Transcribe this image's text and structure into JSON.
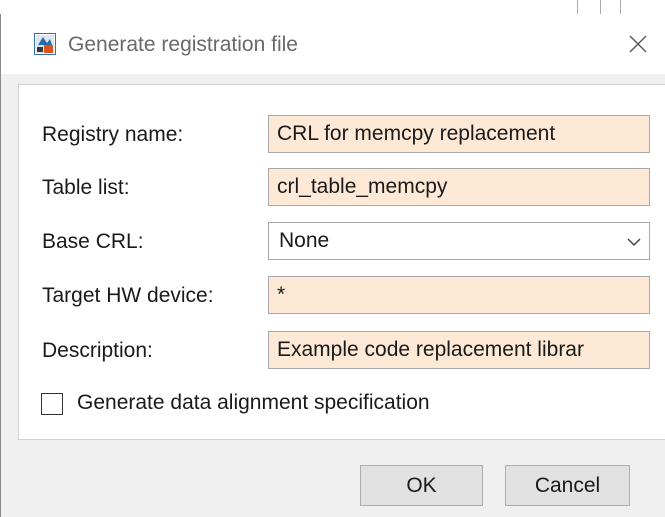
{
  "dialog": {
    "title": "Generate registration file",
    "icon": "simulink-app-icon",
    "close_icon": "close-icon"
  },
  "form": {
    "registry_name": {
      "label": "Registry name:",
      "value": "CRL for memcpy replacement"
    },
    "table_list": {
      "label": "Table list:",
      "value": "crl_table_memcpy"
    },
    "base_crl": {
      "label": "Base CRL:",
      "value": "None"
    },
    "target_hw": {
      "label": "Target HW device:",
      "value": "*"
    },
    "description": {
      "label": "Description:",
      "value": "Example code replacement librar"
    },
    "checkbox": {
      "label": "Generate data alignment specification",
      "checked": false
    }
  },
  "buttons": {
    "ok": "OK",
    "cancel": "Cancel"
  },
  "colors": {
    "field_bg": "#fde9d5",
    "dialog_bg": "#f0f0f0"
  }
}
